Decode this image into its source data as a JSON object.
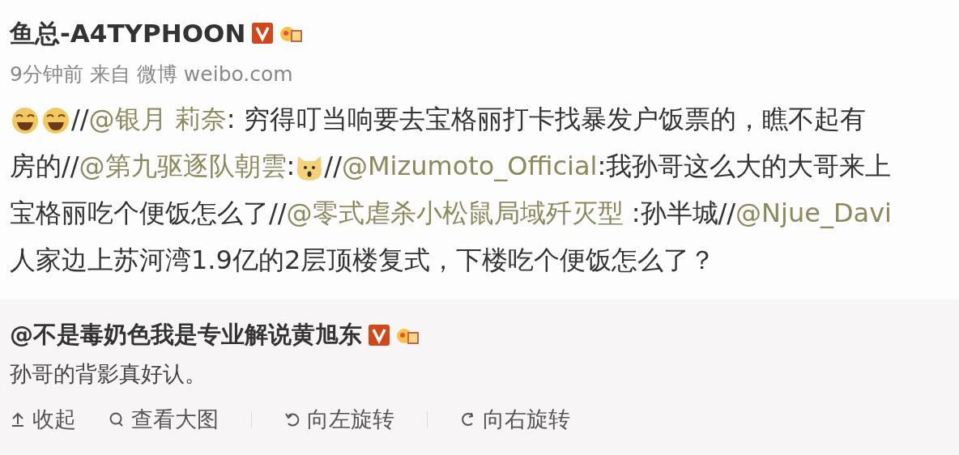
{
  "post": {
    "author": "鱼总-A4TYPHOON",
    "verified": true,
    "medal": true,
    "time": "9分钟前",
    "source_prefix": "来自",
    "source": "微博 weibo.com",
    "lines": [
      [
        {
          "kind": "laugh_emoji"
        },
        {
          "kind": "laugh_emoji"
        },
        {
          "kind": "text",
          "text": "//"
        },
        {
          "kind": "mention",
          "text": "@银月 莉奈"
        },
        {
          "kind": "text",
          "text": ": 穷得叮当响要去宝格丽打卡找暴发户饭票的，瞧不起有"
        }
      ],
      [
        {
          "kind": "text",
          "text": "房的//"
        },
        {
          "kind": "mention",
          "text": "@第九驱逐队朝雲"
        },
        {
          "kind": "text",
          "text": ":"
        },
        {
          "kind": "dog_emoji"
        },
        {
          "kind": "text",
          "text": "//"
        },
        {
          "kind": "mention",
          "text": "@Mizumoto_Official"
        },
        {
          "kind": "text",
          "text": ":我孙哥这么大的大哥来上"
        }
      ],
      [
        {
          "kind": "text",
          "text": "宝格丽吃个便饭怎么了//"
        },
        {
          "kind": "mention",
          "text": "@零式虐杀小松鼠局域歼灭型"
        },
        {
          "kind": "text",
          "text": " :孙半城//"
        },
        {
          "kind": "mention",
          "text": "@Njue_Davi"
        }
      ],
      [
        {
          "kind": "text",
          "text": "人家边上苏河湾1.9亿的2层顶楼复式，下楼吃个便饭怎么了？"
        }
      ]
    ]
  },
  "comment": {
    "author": "@不是毒奶色我是专业解说黄旭东",
    "verified": true,
    "medal": true,
    "text": "孙哥的背影真好认。",
    "actions": [
      {
        "kind": "collapse",
        "label": "收起"
      },
      {
        "kind": "zoom",
        "label": "查看大图"
      },
      {
        "kind": "rotate_left",
        "label": "向左旋转"
      },
      {
        "kind": "rotate_right",
        "label": "向右旋转"
      }
    ]
  }
}
